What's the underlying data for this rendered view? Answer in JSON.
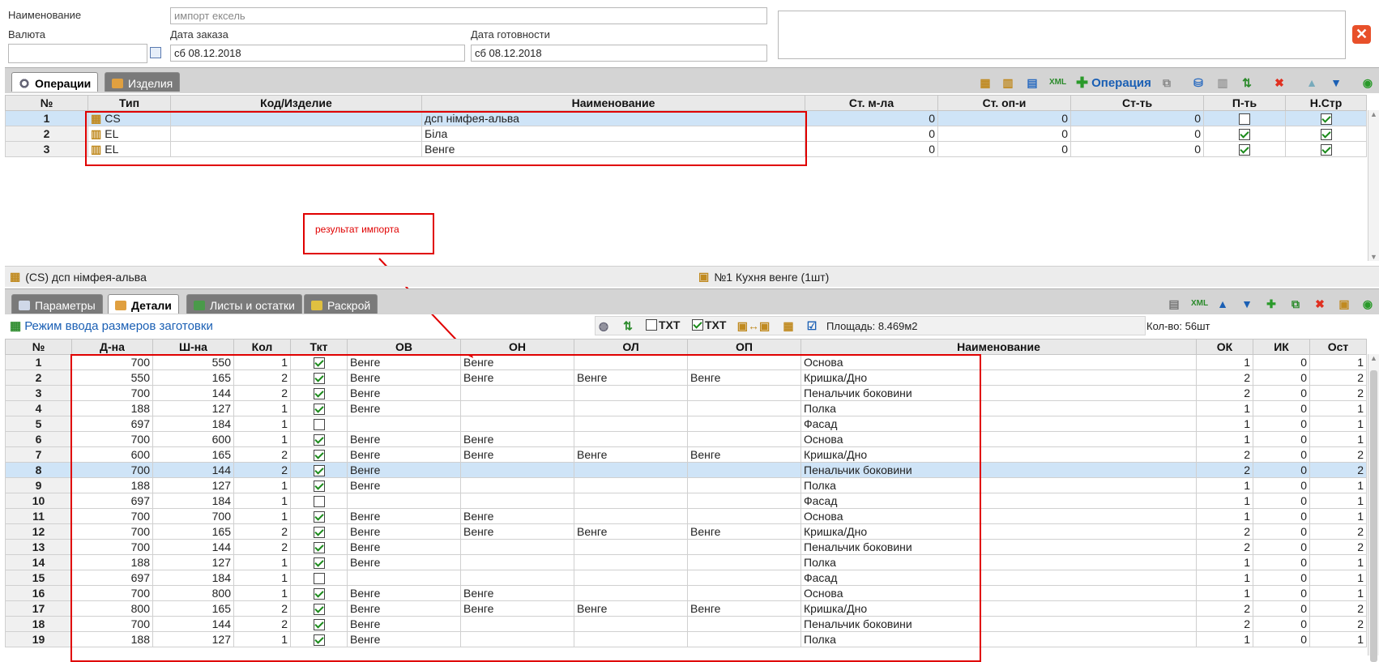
{
  "header": {
    "name_label": "Наименование",
    "name_placeholder": "импорт ексель",
    "currency_label": "Валюта",
    "currency_value": "",
    "order_date_label": "Дата заказа",
    "order_date_value": "сб 08.12.2018",
    "ready_date_label": "Дата готовности",
    "ready_date_value": "сб 08.12.2018"
  },
  "top_tabs": [
    {
      "label": "Операции"
    },
    {
      "label": "Изделия"
    }
  ],
  "top_toolbar": {
    "operation_label": "Операция"
  },
  "operations_table": {
    "columns": [
      "№",
      "Тип",
      "Код/Изделие",
      "Наименование",
      "Ст. м-ла",
      "Ст. оп-и",
      "Ст-ть",
      "П-ть",
      "Н.Стр"
    ],
    "rows": [
      {
        "n": "1",
        "type": "CS",
        "code": "",
        "name": "дсп німфея-альва",
        "mat": "0",
        "op": "0",
        "cost": "0",
        "p": false,
        "ns": true
      },
      {
        "n": "2",
        "type": "EL",
        "code": "",
        "name": "Біла",
        "mat": "0",
        "op": "0",
        "cost": "0",
        "p": true,
        "ns": true
      },
      {
        "n": "3",
        "type": "EL",
        "code": "",
        "name": "Венге",
        "mat": "0",
        "op": "0",
        "cost": "0",
        "p": true,
        "ns": true
      }
    ]
  },
  "annotation": {
    "text": "результат импорта"
  },
  "status_bar": {
    "left": "(CS) дсп німфея-альва",
    "right": "№1 Кухня венге (1шт)"
  },
  "bottom_tabs": [
    {
      "label": "Параметры"
    },
    {
      "label": "Детали"
    },
    {
      "label": "Листы и остатки"
    },
    {
      "label": "Раскрой"
    }
  ],
  "details_toolbar": {
    "mode_label": "Режим ввода размеров заготовки",
    "txt1": "TXT",
    "txt2": "TXT",
    "area": "Площадь: 8.469м2",
    "count": "Кол-во: 56шт"
  },
  "details_table": {
    "columns": [
      "№",
      "Д-на",
      "Ш-на",
      "Кол",
      "Ткт",
      "ОВ",
      "ОН",
      "ОЛ",
      "ОП",
      "Наименование",
      "ОК",
      "ИК",
      "Ост"
    ],
    "rows": [
      {
        "n": "1",
        "d": "700",
        "w": "550",
        "q": "1",
        "t": true,
        "ob": "Венге",
        "on": "Венге",
        "ol": "",
        "op": "",
        "name": "Основа",
        "ok": "1",
        "ik": "0",
        "ost": "1"
      },
      {
        "n": "2",
        "d": "550",
        "w": "165",
        "q": "2",
        "t": true,
        "ob": "Венге",
        "on": "Венге",
        "ol": "Венге",
        "op": "Венге",
        "name": "Кришка/Дно",
        "ok": "2",
        "ik": "0",
        "ost": "2"
      },
      {
        "n": "3",
        "d": "700",
        "w": "144",
        "q": "2",
        "t": true,
        "ob": "Венге",
        "on": "",
        "ol": "",
        "op": "",
        "name": "Пенальчик боковини",
        "ok": "2",
        "ik": "0",
        "ost": "2"
      },
      {
        "n": "4",
        "d": "188",
        "w": "127",
        "q": "1",
        "t": true,
        "ob": "Венге",
        "on": "",
        "ol": "",
        "op": "",
        "name": "Полка",
        "ok": "1",
        "ik": "0",
        "ost": "1"
      },
      {
        "n": "5",
        "d": "697",
        "w": "184",
        "q": "1",
        "t": false,
        "ob": "",
        "on": "",
        "ol": "",
        "op": "",
        "name": "Фасад",
        "ok": "1",
        "ik": "0",
        "ost": "1"
      },
      {
        "n": "6",
        "d": "700",
        "w": "600",
        "q": "1",
        "t": true,
        "ob": "Венге",
        "on": "Венге",
        "ol": "",
        "op": "",
        "name": "Основа",
        "ok": "1",
        "ik": "0",
        "ost": "1"
      },
      {
        "n": "7",
        "d": "600",
        "w": "165",
        "q": "2",
        "t": true,
        "ob": "Венге",
        "on": "Венге",
        "ol": "Венге",
        "op": "Венге",
        "name": "Кришка/Дно",
        "ok": "2",
        "ik": "0",
        "ost": "2"
      },
      {
        "n": "8",
        "d": "700",
        "w": "144",
        "q": "2",
        "t": true,
        "ob": "Венге",
        "on": "",
        "ol": "",
        "op": "",
        "name": "Пенальчик боковини",
        "ok": "2",
        "ik": "0",
        "ost": "2"
      },
      {
        "n": "9",
        "d": "188",
        "w": "127",
        "q": "1",
        "t": true,
        "ob": "Венге",
        "on": "",
        "ol": "",
        "op": "",
        "name": "Полка",
        "ok": "1",
        "ik": "0",
        "ost": "1"
      },
      {
        "n": "10",
        "d": "697",
        "w": "184",
        "q": "1",
        "t": false,
        "ob": "",
        "on": "",
        "ol": "",
        "op": "",
        "name": "Фасад",
        "ok": "1",
        "ik": "0",
        "ost": "1"
      },
      {
        "n": "11",
        "d": "700",
        "w": "700",
        "q": "1",
        "t": true,
        "ob": "Венге",
        "on": "Венге",
        "ol": "",
        "op": "",
        "name": "Основа",
        "ok": "1",
        "ik": "0",
        "ost": "1"
      },
      {
        "n": "12",
        "d": "700",
        "w": "165",
        "q": "2",
        "t": true,
        "ob": "Венге",
        "on": "Венге",
        "ol": "Венге",
        "op": "Венге",
        "name": "Кришка/Дно",
        "ok": "2",
        "ik": "0",
        "ost": "2"
      },
      {
        "n": "13",
        "d": "700",
        "w": "144",
        "q": "2",
        "t": true,
        "ob": "Венге",
        "on": "",
        "ol": "",
        "op": "",
        "name": "Пенальчик боковини",
        "ok": "2",
        "ik": "0",
        "ost": "2"
      },
      {
        "n": "14",
        "d": "188",
        "w": "127",
        "q": "1",
        "t": true,
        "ob": "Венге",
        "on": "",
        "ol": "",
        "op": "",
        "name": "Полка",
        "ok": "1",
        "ik": "0",
        "ost": "1"
      },
      {
        "n": "15",
        "d": "697",
        "w": "184",
        "q": "1",
        "t": false,
        "ob": "",
        "on": "",
        "ol": "",
        "op": "",
        "name": "Фасад",
        "ok": "1",
        "ik": "0",
        "ost": "1"
      },
      {
        "n": "16",
        "d": "700",
        "w": "800",
        "q": "1",
        "t": true,
        "ob": "Венге",
        "on": "Венге",
        "ol": "",
        "op": "",
        "name": "Основа",
        "ok": "1",
        "ik": "0",
        "ost": "1"
      },
      {
        "n": "17",
        "d": "800",
        "w": "165",
        "q": "2",
        "t": true,
        "ob": "Венге",
        "on": "Венге",
        "ol": "Венге",
        "op": "Венге",
        "name": "Кришка/Дно",
        "ok": "2",
        "ik": "0",
        "ost": "2"
      },
      {
        "n": "18",
        "d": "700",
        "w": "144",
        "q": "2",
        "t": true,
        "ob": "Венге",
        "on": "",
        "ol": "",
        "op": "",
        "name": "Пенальчик боковини",
        "ok": "2",
        "ik": "0",
        "ost": "2"
      },
      {
        "n": "19",
        "d": "188",
        "w": "127",
        "q": "1",
        "t": true,
        "ob": "Венге",
        "on": "",
        "ol": "",
        "op": "",
        "name": "Полка",
        "ok": "1",
        "ik": "0",
        "ost": "1"
      }
    ]
  },
  "colors": {
    "accent_red": "#e00000",
    "selection": "#cfe4f7",
    "tab_inactive": "#7a7a7a"
  }
}
